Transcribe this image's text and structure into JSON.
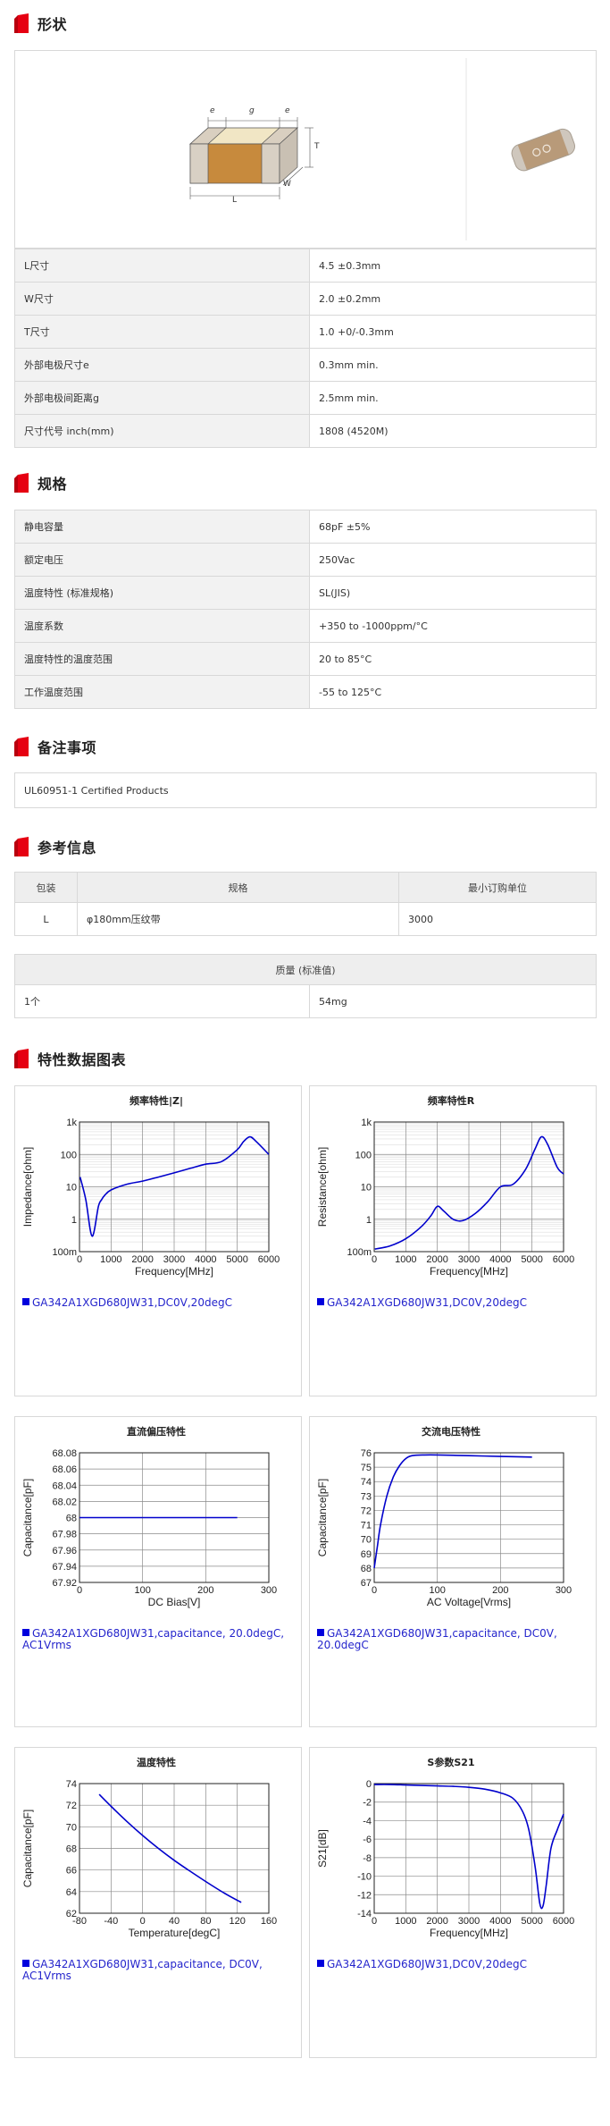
{
  "sections": {
    "shape": "形状",
    "specs": "规格",
    "notes": "备注事项",
    "reference": "参考信息",
    "charts": "特性数据图表"
  },
  "diagram": {
    "e1": "e",
    "g": "g",
    "e2": "e",
    "T": "T",
    "L": "L",
    "W": "W"
  },
  "dimensions": [
    {
      "label": "L尺寸",
      "value": "4.5 ±0.3mm"
    },
    {
      "label": "W尺寸",
      "value": "2.0 ±0.2mm"
    },
    {
      "label": "T尺寸",
      "value": "1.0 +0/-0.3mm"
    },
    {
      "label": "外部电极尺寸e",
      "value": "0.3mm min."
    },
    {
      "label": "外部电极间距离g",
      "value": "2.5mm min."
    },
    {
      "label": "尺寸代号 inch(mm)",
      "value": "1808 (4520M)"
    }
  ],
  "specs": [
    {
      "label": "静电容量",
      "value": "68pF ±5%"
    },
    {
      "label": "额定电压",
      "value": "250Vac"
    },
    {
      "label": "温度特性 (标准规格)",
      "value": "SL(JIS)"
    },
    {
      "label": "温度系数",
      "value": "+350 to -1000ppm/°C"
    },
    {
      "label": "温度特性的温度范围",
      "value": "20 to 85°C"
    },
    {
      "label": "工作温度范围",
      "value": "-55 to 125°C"
    }
  ],
  "notes": "UL60951-1 Certified Products",
  "packaging": {
    "headers": [
      "包装",
      "规格",
      "最小订购单位"
    ],
    "row": [
      "L",
      "φ180mm压纹带",
      "3000"
    ]
  },
  "mass": {
    "header": "质量 (标准值)",
    "label": "1个",
    "value": "54mg"
  },
  "colors": {
    "accent": "#e60012",
    "curve": "#0000cc"
  },
  "chart_data": [
    {
      "type": "line",
      "title": "频率特性|Z|",
      "xlabel": "Frequency[MHz]",
      "ylabel": "Impedance[ohm]",
      "xlim": [
        0,
        6000
      ],
      "ylim": [
        0.1,
        1000
      ],
      "yscale": "log",
      "xticks": [
        "0",
        "1000",
        "2000",
        "3000",
        "4000",
        "5000",
        "6000"
      ],
      "yticks": [
        "100m",
        "1",
        "10",
        "100",
        "1k"
      ],
      "x": [
        20,
        200,
        400,
        600,
        700,
        800,
        1000,
        1500,
        2000,
        2500,
        3000,
        3500,
        4000,
        4500,
        5000,
        5200,
        5400,
        5600,
        6000
      ],
      "y": [
        20,
        4,
        0.3,
        2.5,
        4,
        5.5,
        8,
        12,
        15,
        20,
        27,
        37,
        50,
        60,
        140,
        250,
        350,
        250,
        100
      ],
      "legend": "GA342A1XGD680JW31,DC0V,20degC"
    },
    {
      "type": "line",
      "title": "频率特性R",
      "xlabel": "Frequency[MHz]",
      "ylabel": "Resistance[ohm]",
      "xlim": [
        0,
        6000
      ],
      "ylim": [
        0.1,
        1000
      ],
      "yscale": "log",
      "xticks": [
        "0",
        "1000",
        "2000",
        "3000",
        "4000",
        "5000",
        "6000"
      ],
      "yticks": [
        "100m",
        "1",
        "10",
        "100",
        "1k"
      ],
      "x": [
        20,
        500,
        1000,
        1500,
        1800,
        2000,
        2200,
        2500,
        2800,
        3200,
        3600,
        4000,
        4400,
        4800,
        5100,
        5300,
        5500,
        5800,
        6000
      ],
      "y": [
        0.12,
        0.15,
        0.25,
        0.6,
        1.3,
        2.5,
        1.8,
        1,
        0.9,
        1.5,
        3.5,
        10,
        12,
        35,
        150,
        350,
        200,
        40,
        25
      ],
      "legend": "GA342A1XGD680JW31,DC0V,20degC"
    },
    {
      "type": "line",
      "title": "直流偏压特性",
      "xlabel": "DC Bias[V]",
      "ylabel": "Capacitance[pF]",
      "xlim": [
        0,
        300
      ],
      "ylim": [
        67.92,
        68.08
      ],
      "xticks": [
        "0",
        "100",
        "200",
        "300"
      ],
      "yticks": [
        "67.92",
        "67.94",
        "67.96",
        "67.98",
        "68",
        "68.02",
        "68.04",
        "68.06",
        "68.08"
      ],
      "x": [
        0,
        50,
        100,
        150,
        200,
        250
      ],
      "y": [
        68,
        68,
        68,
        68,
        68,
        68
      ],
      "legend": "GA342A1XGD680JW31,capacitance, 20.0degC, AC1Vrms"
    },
    {
      "type": "line",
      "title": "交流电压特性",
      "xlabel": "AC Voltage[Vrms]",
      "ylabel": "Capacitance[pF]",
      "xlim": [
        0,
        300
      ],
      "ylim": [
        67,
        76
      ],
      "xticks": [
        "0",
        "100",
        "200",
        "300"
      ],
      "yticks": [
        "67",
        "68",
        "69",
        "70",
        "71",
        "72",
        "73",
        "74",
        "75",
        "76"
      ],
      "x": [
        0,
        5,
        10,
        20,
        30,
        40,
        50,
        60,
        80,
        100,
        150,
        200,
        250
      ],
      "y": [
        68,
        69.5,
        71,
        73,
        74.3,
        75.1,
        75.6,
        75.8,
        75.85,
        75.85,
        75.8,
        75.75,
        75.7
      ],
      "legend": "GA342A1XGD680JW31,capacitance, DC0V, 20.0degC"
    },
    {
      "type": "line",
      "title": "温度特性",
      "xlabel": "Temperature[degC]",
      "ylabel": "Capacitance[pF]",
      "xlim": [
        -80,
        160
      ],
      "ylim": [
        62,
        74
      ],
      "xticks": [
        "-80",
        "-40",
        "0",
        "40",
        "80",
        "120",
        "160"
      ],
      "yticks": [
        "62",
        "64",
        "66",
        "68",
        "70",
        "72",
        "74"
      ],
      "x": [
        -55,
        -40,
        -20,
        0,
        20,
        40,
        60,
        85,
        105,
        125
      ],
      "y": [
        73,
        71.9,
        70.5,
        69.2,
        68,
        66.9,
        65.9,
        64.7,
        63.8,
        63
      ],
      "legend": "GA342A1XGD680JW31,capacitance, DC0V, AC1Vrms"
    },
    {
      "type": "line",
      "title": "S参数S21",
      "xlabel": "Frequency[MHz]",
      "ylabel": "S21[dB]",
      "xlim": [
        0,
        6000
      ],
      "ylim": [
        -14,
        0
      ],
      "xticks": [
        "0",
        "1000",
        "2000",
        "3000",
        "4000",
        "5000",
        "6000"
      ],
      "yticks": [
        "0",
        "-2",
        "-4",
        "-6",
        "-8",
        "-10",
        "-12",
        "-14"
      ],
      "x": [
        0,
        500,
        1000,
        1500,
        2000,
        2500,
        3000,
        3500,
        4000,
        4400,
        4700,
        4900,
        5100,
        5250,
        5350,
        5450,
        5600,
        5800,
        6000
      ],
      "y": [
        -0.1,
        -0.1,
        -0.15,
        -0.2,
        -0.25,
        -0.3,
        -0.4,
        -0.6,
        -1.0,
        -1.6,
        -3,
        -5,
        -9,
        -13,
        -13.2,
        -11,
        -7,
        -5,
        -3.3
      ],
      "legend": "GA342A1XGD680JW31,DC0V,20degC"
    }
  ]
}
